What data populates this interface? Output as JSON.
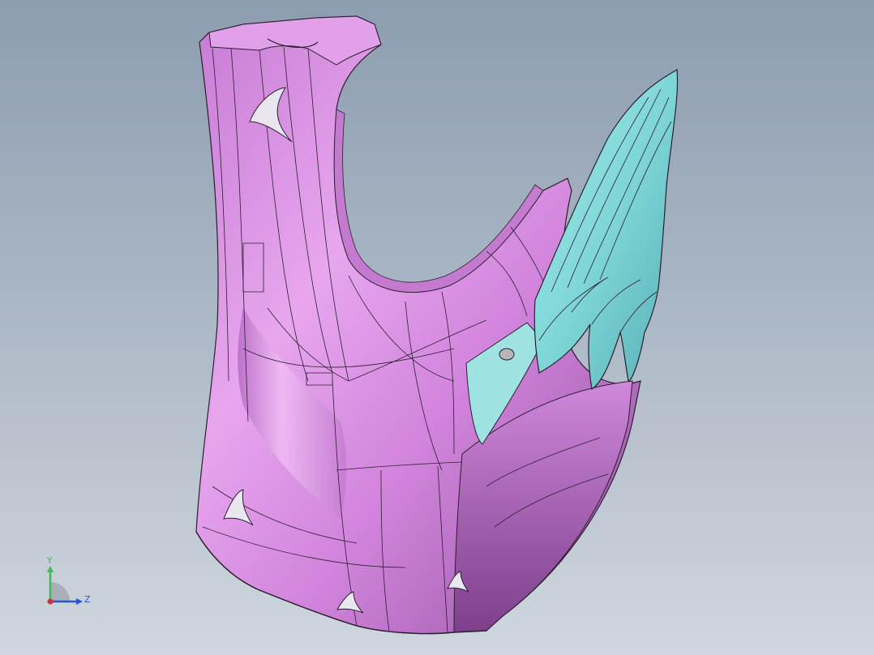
{
  "viewport": {
    "background_top": "#8d9db0",
    "background_bottom": "#cfd6de"
  },
  "model": {
    "body_color": "#d88ce4",
    "body_shadow_color": "#9a5aa6",
    "body_highlight_color": "#f3c6f7",
    "wing_color": "#7fd6d6",
    "wing_shadow_color": "#4fa8b0",
    "edge_color": "#2b1f2e",
    "hole_color": "#e9e6f0"
  },
  "triad": {
    "y_label": "Y",
    "z_label": "Z",
    "y_color": "#33c24a",
    "z_color": "#2a55d6",
    "x_color": "#d63030"
  }
}
